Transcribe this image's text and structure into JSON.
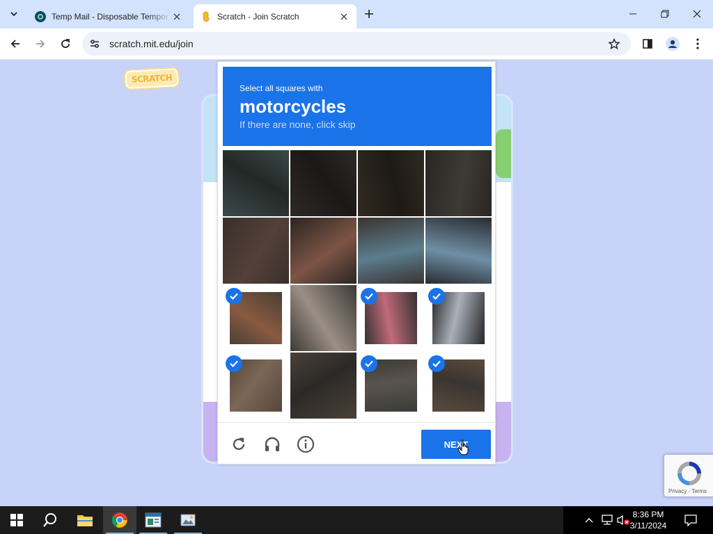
{
  "browser": {
    "tabs": [
      {
        "title": "Temp Mail - Disposable Tempor",
        "active": false
      },
      {
        "title": "Scratch - Join Scratch",
        "active": true
      }
    ],
    "url": "scratch.mit.edu/join"
  },
  "page": {
    "logo_text": "SCRATCH"
  },
  "captcha": {
    "lead": "Select all squares with",
    "target": "motorcycles",
    "hint": "If there are none, click skip",
    "selected_tiles": [
      8,
      10,
      11,
      12,
      14,
      15,
      16
    ],
    "next_label": "NEXT",
    "footer_icons": [
      "reload-icon",
      "audio-icon",
      "info-icon"
    ]
  },
  "recaptcha": {
    "terms": "Privacy - Terms"
  },
  "taskbar": {
    "time": "8:36 PM",
    "date": "3/11/2024",
    "apps": [
      "start-icon",
      "search-icon",
      "file-explorer-icon",
      "chrome-icon",
      "app-icon",
      "app-icon-2"
    ]
  },
  "colors": {
    "accent": "#1a73e8",
    "page_bg": "#c7d3f8"
  }
}
